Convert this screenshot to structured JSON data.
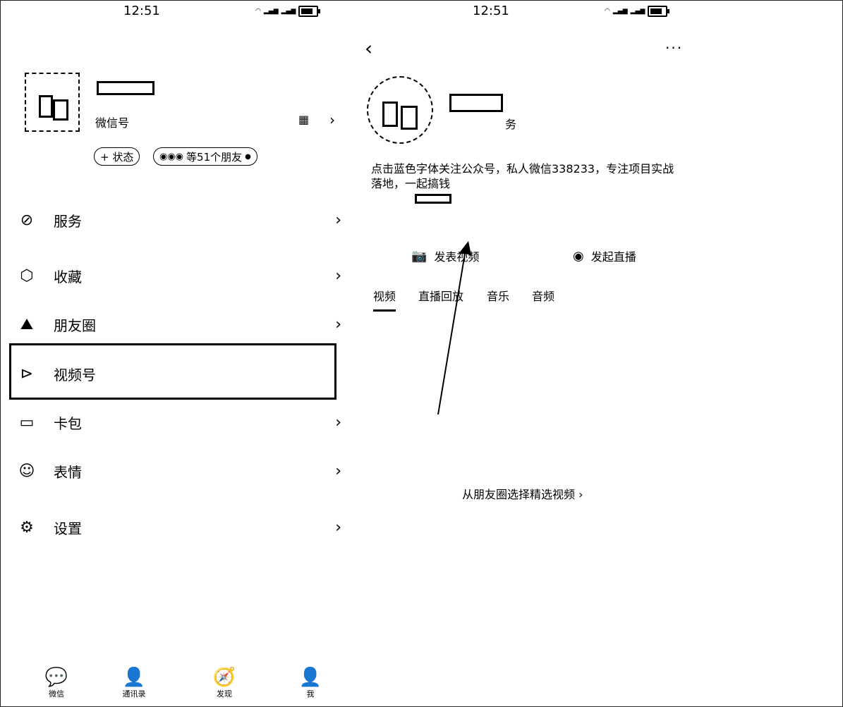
{
  "left": {
    "status_time": "12:51",
    "profile": {
      "wechat_id_label": "微信号"
    },
    "status_button": "+ 状态",
    "friends_pill": "等51个朋友",
    "menu": [
      {
        "label": "服务",
        "icon": "service-icon"
      },
      {
        "label": "收藏",
        "icon": "cube-icon"
      },
      {
        "label": "朋友圈",
        "icon": "image-icon"
      },
      {
        "label": "视频号",
        "icon": "play-icon"
      },
      {
        "label": "卡包",
        "icon": "wallet-icon"
      },
      {
        "label": "表情",
        "icon": "smile-icon"
      },
      {
        "label": "设置",
        "icon": "gear-icon"
      }
    ],
    "bottom_nav": [
      "微信",
      "通讯录",
      "发现",
      "我"
    ]
  },
  "right": {
    "status_time": "12:51",
    "bio": "点击蓝色字体关注公众号，私人微信338233，专注项目实战落地，一起搞钱",
    "name_suffix": "务",
    "publish_video": "发表视频",
    "start_live": "发起直播",
    "tabs": [
      "视频",
      "直播回放",
      "音乐",
      "音频"
    ],
    "select_from_moments": "从朋友圈选择精选视频 ›"
  },
  "colors": {
    "highlight_border": "#000000"
  }
}
